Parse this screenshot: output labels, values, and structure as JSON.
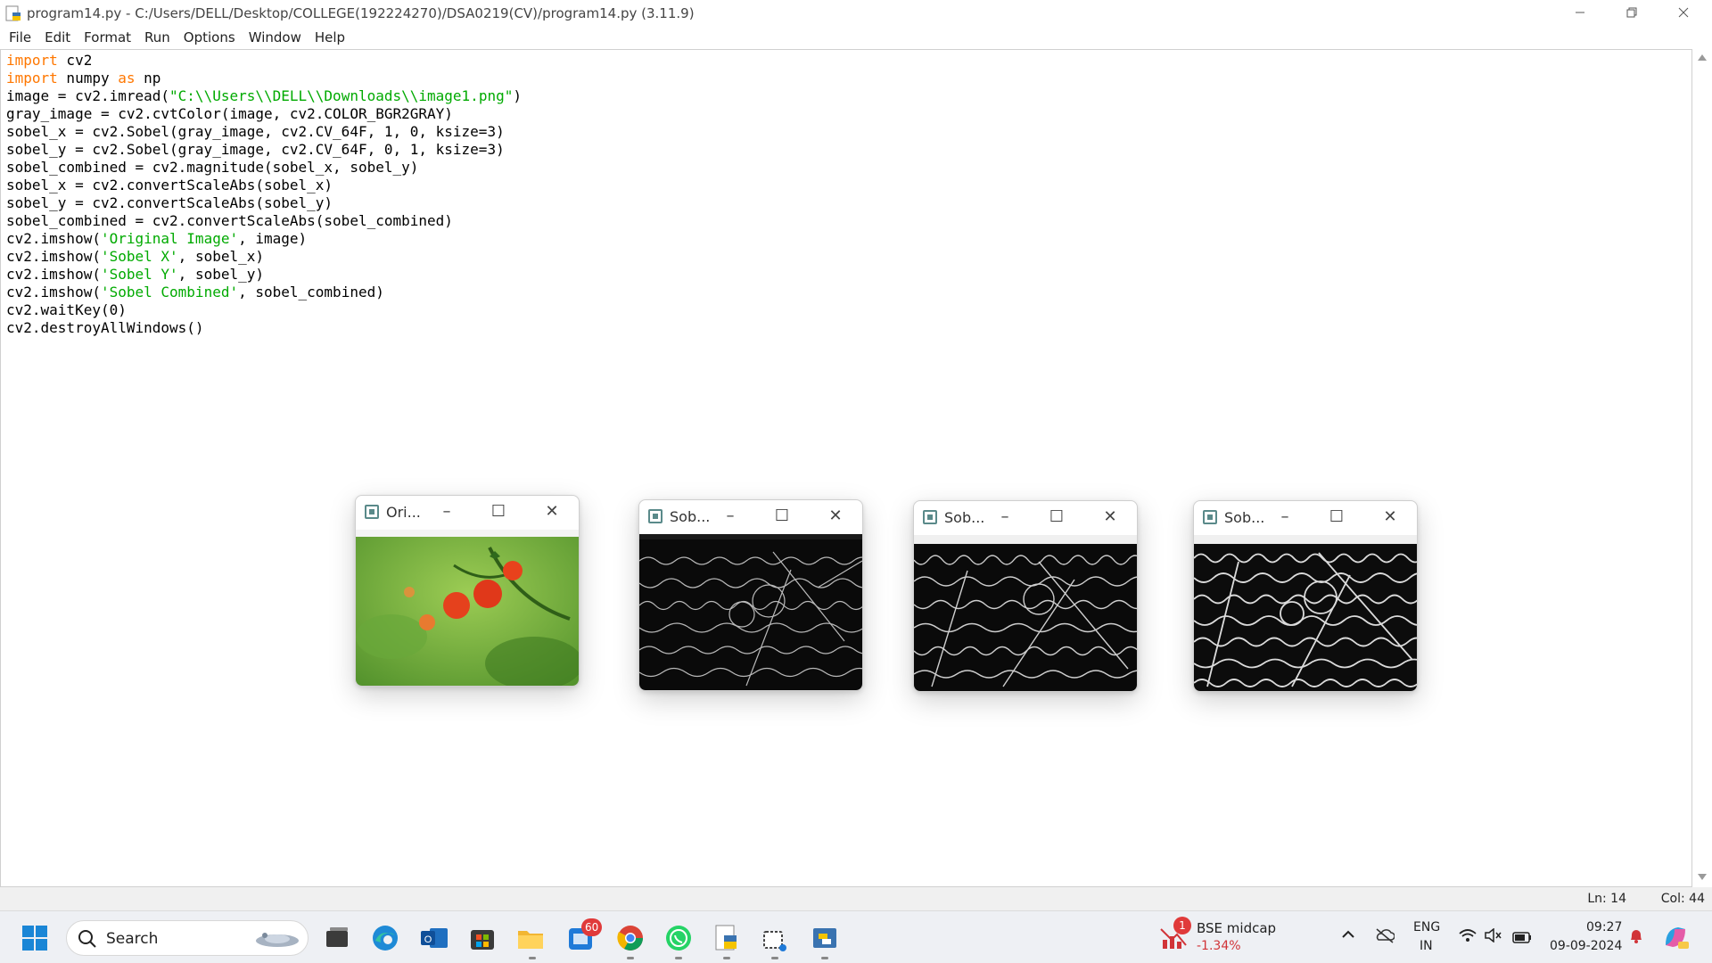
{
  "window": {
    "title": "program14.py - C:/Users/DELL/Desktop/COLLEGE(192224270)/DSA0219(CV)/program14.py (3.11.9)"
  },
  "menu": [
    "File",
    "Edit",
    "Format",
    "Run",
    "Options",
    "Window",
    "Help"
  ],
  "status": {
    "line": "Ln: 14",
    "col": "Col: 44"
  },
  "cv_windows": [
    {
      "title": "Ori..."
    },
    {
      "title": "Sob..."
    },
    {
      "title": "Sob..."
    },
    {
      "title": "Sob..."
    }
  ],
  "taskbar": {
    "search_label": "Search",
    "badge_store": "60",
    "stock": {
      "name": "BSE midcap",
      "change": "-1.34%",
      "alert": "1"
    },
    "lang": {
      "line1": "ENG",
      "line2": "IN"
    },
    "clock": {
      "time": "09:27",
      "date": "09-09-2024"
    }
  },
  "icons": {
    "app": "python-idle-icon",
    "minimize": "minimize-icon",
    "restore": "restore-icon",
    "close": "close-icon",
    "windows": "windows-start-icon",
    "search": "search-icon",
    "notification": "bell-icon",
    "wifi": "wifi-icon",
    "volume": "volume-muted-icon",
    "battery": "battery-icon"
  },
  "colors": {
    "keyword": "#ff7700",
    "string": "#00aa00",
    "taskbar": "#eef0f4",
    "badge": "#e03a3a",
    "stock_negative": "#d13438"
  }
}
